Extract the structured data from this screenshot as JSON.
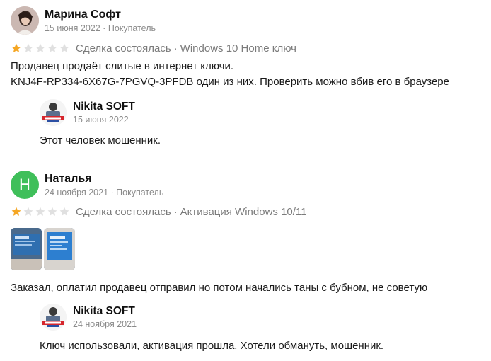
{
  "reviews": [
    {
      "author": "Марина Софт",
      "date": "15 июня 2022",
      "role": "Покупатель",
      "rating": 1,
      "rating_max": 5,
      "deal_status": "Сделка состоялась",
      "product": "Windows 10 Home ключ",
      "text_line1": "Продавец продаёт слитые в интернет ключи.",
      "text_line2": "KNJ4F-RP334-6X67G-7PGVQ-3PFDB один из них. Проверить можно вбив его в браузере",
      "reply": {
        "author": "Nikita SOFT",
        "date": "15 июня 2022",
        "text": "Этот человек мошенник."
      }
    },
    {
      "author": "Наталья",
      "avatar_letter": "Н",
      "date": "24 ноября 2021",
      "role": "Покупатель",
      "rating": 1,
      "rating_max": 5,
      "deal_status": "Сделка состоялась",
      "product": "Активация Windows 10/11",
      "text": "Заказал, оплатил продавец отправил но потом начались таны с бубном, не советую",
      "reply": {
        "author": "Nikita SOFT",
        "date": "24 ноября 2021",
        "text": "Ключ использовали, активация прошла. Хотели обмануть, мошенник."
      }
    }
  ],
  "separator": "·",
  "colors": {
    "star_filled": "#f5a623",
    "star_empty": "#e0e0e0",
    "avatar_green": "#3fbf5a",
    "meta_gray": "#8a8a8a"
  }
}
